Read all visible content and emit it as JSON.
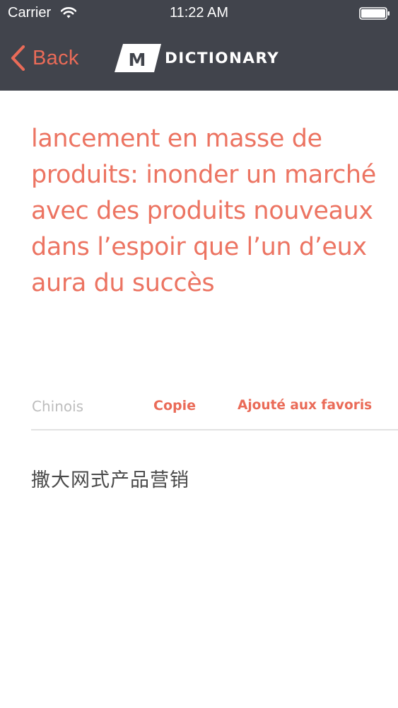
{
  "status_bar": {
    "carrier": "Carrier",
    "time": "11:22 AM",
    "wifi_icon": "wifi-icon",
    "battery_icon": "battery-icon"
  },
  "nav": {
    "back_label": "Back",
    "back_icon": "chevron-left-icon",
    "logo_letter": "M",
    "title": "DICTIONARY",
    "background_color": "#41444c",
    "accent_color": "#ea6b58"
  },
  "entry": {
    "definition": "lancement en masse de produits: inonder un marché avec des produits nouveaux dans l’espoir que l’un d’eux aura du succès",
    "language_label": "Chinois",
    "copy_label": "Copie",
    "favorite_label": "Ajouté aux favoris",
    "translation": "撒大网式产品营销",
    "definition_color": "#ec7462",
    "muted_color": "#bdbdbd"
  }
}
